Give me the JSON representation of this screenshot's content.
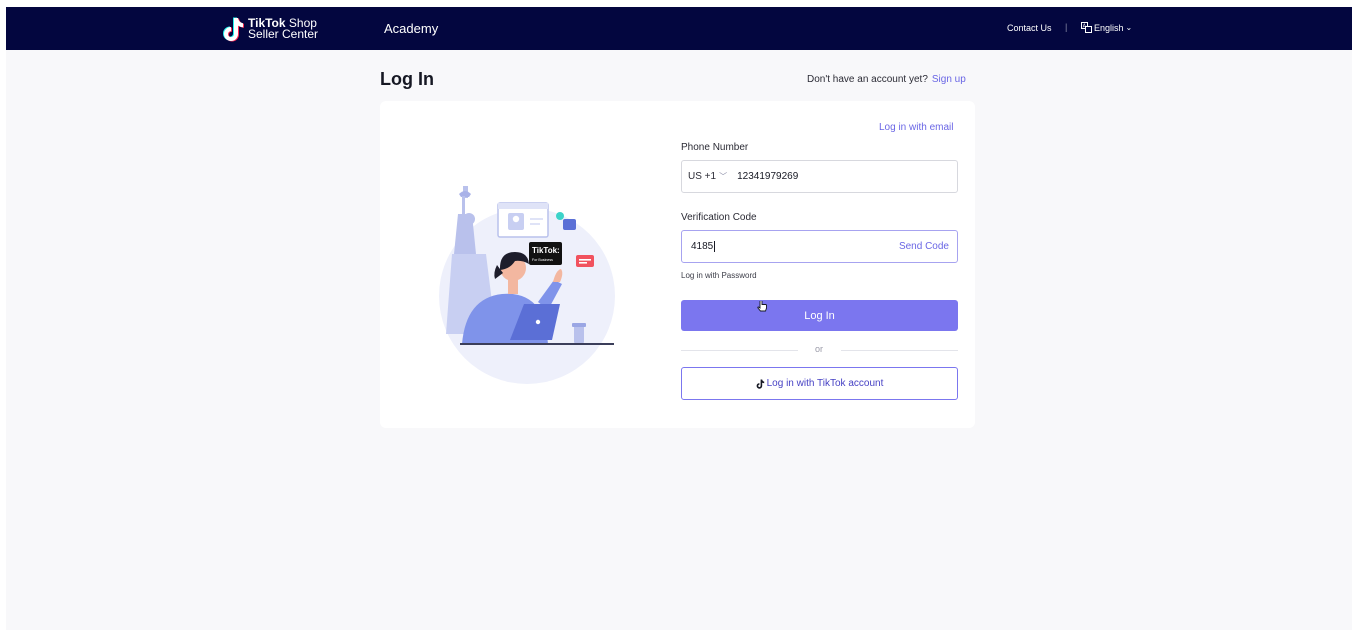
{
  "header": {
    "logo_line1_bold": "TikTok",
    "logo_line1_light": "Shop",
    "logo_line2": "Seller Center",
    "academy": "Academy",
    "contact": "Contact Us",
    "separator": "|",
    "language": "English"
  },
  "page": {
    "title": "Log In",
    "no_account_text": "Don't have an account yet?",
    "sign_up": "Sign up"
  },
  "illustration": {
    "badge_brand": "TikTok:",
    "badge_sub": "For Business"
  },
  "form": {
    "email_link": "Log in with email",
    "phone_label": "Phone Number",
    "country_code": "US +1",
    "phone_value": "12341979269",
    "code_label": "Verification Code",
    "code_value": "4185",
    "send_code": "Send Code",
    "password_link": "Log in with Password",
    "login_button": "Log In",
    "or_text": "or",
    "tiktok_button": "Log in with TikTok account"
  },
  "colors": {
    "header_bg": "#03063f",
    "accent": "#7b76ef",
    "link": "#6a66e5",
    "page_bg": "#f8f8fa"
  }
}
